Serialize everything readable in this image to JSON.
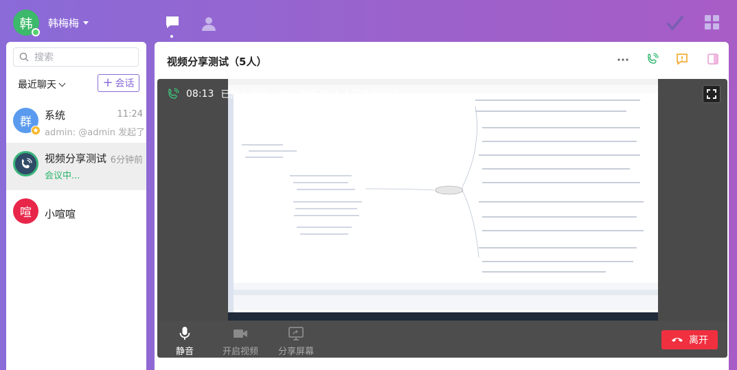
{
  "user": {
    "avatar_char": "韩",
    "name": "韩梅梅"
  },
  "colors": {
    "accent": "#8a6bd8",
    "online": "#52d36b",
    "green": "#29b46a",
    "leave": "#f0303f"
  },
  "left": {
    "search_placeholder": "搜索",
    "recent_label": "最近聊天",
    "new_chat_label": "会话",
    "chats": [
      {
        "avatar_char": "群",
        "name": "系统",
        "time": "11:24",
        "subtitle": "admin: @admin 发起了…"
      },
      {
        "avatar_char": "",
        "name": "视频分享测试",
        "time": "6分钟前",
        "subtitle": "会议中..."
      },
      {
        "avatar_char": "喧",
        "name": "小喧喧",
        "time": "",
        "subtitle": ""
      }
    ]
  },
  "main": {
    "title": "视频分享测试（5人）",
    "call_time": "08:13",
    "call_status": "已加入会议，我，李娟 共 2 人正在会议中……",
    "controls": {
      "mute": "静音",
      "video": "开启视频",
      "share": "分享屏幕",
      "leave": "离开"
    }
  }
}
